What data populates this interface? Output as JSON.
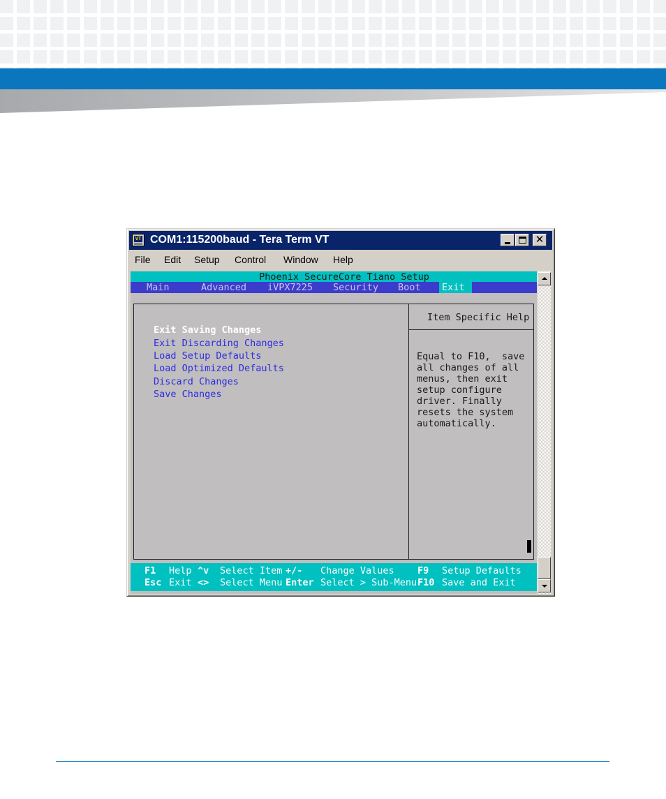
{
  "window": {
    "title": "COM1:115200baud - Tera Term VT",
    "icon_label": "VT"
  },
  "menubar": [
    "File",
    "Edit",
    "Setup",
    "Control",
    "Window",
    "Help"
  ],
  "bios": {
    "title": "Phoenix SecureCore Tiano Setup",
    "tabs": [
      "Main",
      "Advanced",
      "iVPX7225",
      "Security",
      "Boot",
      "Exit"
    ],
    "active_tab": "Exit",
    "menu_items": [
      "Exit Saving Changes",
      "Exit Discarding Changes",
      "Load Setup Defaults",
      "Load Optimized Defaults",
      "Discard Changes",
      "Save Changes"
    ],
    "selected_item": "Exit Saving Changes",
    "help_title": "Item Specific Help",
    "help_lines": [
      "Equal to F10,  save",
      "all changes of all",
      "menus, then exit",
      "setup configure",
      "driver. Finally",
      "resets the system",
      "automatically."
    ]
  },
  "keys": {
    "row1": [
      {
        "key": "F1",
        "desc": "Help"
      },
      {
        "key": "^v",
        "desc": "Select Item"
      },
      {
        "key": "+/-",
        "desc": "Change Values"
      },
      {
        "key": "F9",
        "desc": "Setup Defaults"
      }
    ],
    "row2": [
      {
        "key": "Esc",
        "desc": "Exit"
      },
      {
        "key": "<>",
        "desc": "Select Menu"
      },
      {
        "key": "Enter",
        "desc": "Select > Sub-Menu"
      },
      {
        "key": "F10",
        "desc": "Save and Exit"
      }
    ]
  },
  "colors": {
    "title_bar": "#0a246a",
    "bios_cyan": "#00c0c0",
    "bios_blue": "#3c3ccc",
    "menu_text": "#2c2ce0",
    "doc_blue": "#0a76bd"
  }
}
